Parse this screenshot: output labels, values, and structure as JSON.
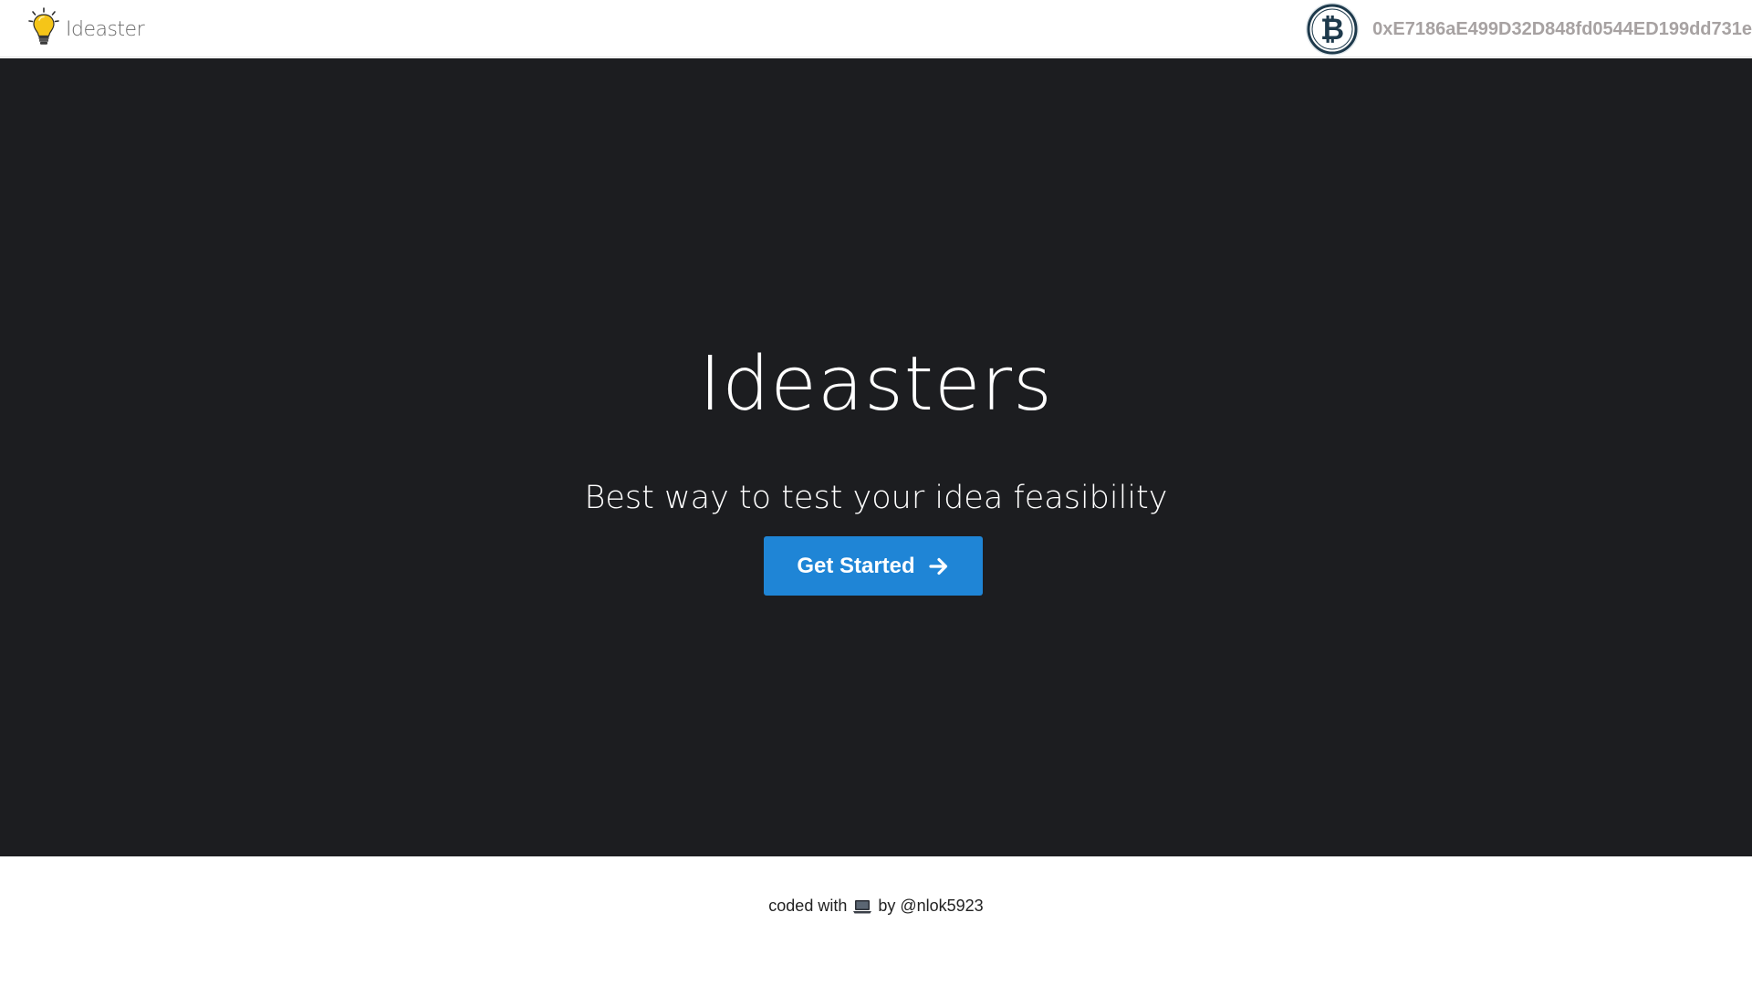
{
  "navbar": {
    "brand_name": "Ideaster",
    "brand_icon": "lightbulb-icon",
    "wallet_icon": "bitcoin-icon",
    "wallet_address": "0xE7186aE499D32D848fd0544ED199dd731e"
  },
  "hero": {
    "title": "Ideasters",
    "subtitle": "Best way to test your idea feasibility",
    "cta_label": "Get Started",
    "cta_icon": "arrow-right-icon"
  },
  "footer": {
    "prefix": "coded with",
    "icon": "laptop-icon",
    "suffix": "by @nlok5923"
  },
  "colors": {
    "hero_background": "#1c1d20",
    "cta_background": "#1f85d6",
    "wallet_text": "#a7a2a2",
    "bulb_yellow": "#f5c518"
  }
}
